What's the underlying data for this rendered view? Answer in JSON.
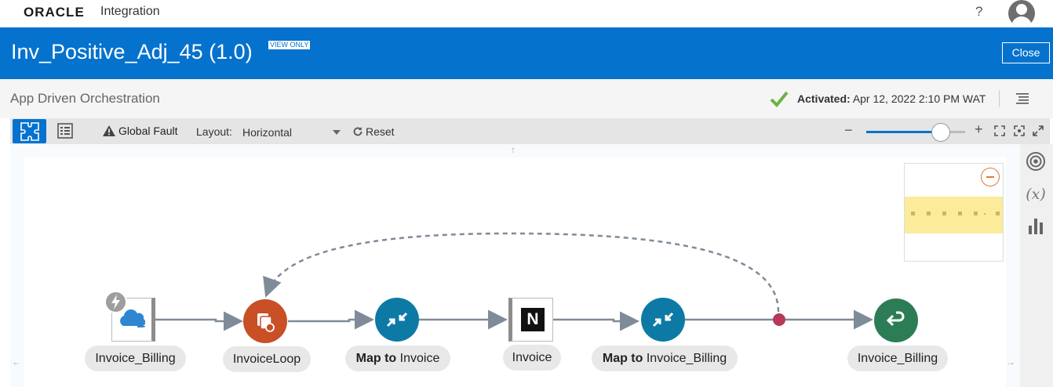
{
  "brand": {
    "logo": "ORACLE",
    "product": "Integration"
  },
  "header": {
    "help": "?"
  },
  "integration": {
    "title": "Inv_Positive_Adj_45 (1.0)",
    "badge": "VIEW ONLY",
    "close_label": "Close"
  },
  "subheader": {
    "pattern": "App Driven Orchestration",
    "status_label": "Activated:",
    "status_value": "Apr 12, 2022 2:10 PM WAT"
  },
  "toolbar": {
    "global_fault": "Global Fault",
    "layout_label": "Layout:",
    "layout_value": "Horizontal",
    "reset": "Reset",
    "zoom_minus": "−",
    "zoom_plus": "+",
    "zoom_level": 0.75
  },
  "flow": {
    "nodes": [
      {
        "id": "trigger",
        "label": "Invoice_Billing",
        "icon": "cloud-app-icon"
      },
      {
        "id": "loop",
        "label": "InvoiceLoop",
        "icon": "for-each-icon",
        "color": "#c84f26"
      },
      {
        "id": "map1",
        "label_prefix": "Map to",
        "label_suffix": " Invoice",
        "icon": "map-icon",
        "color": "#0d7aa6"
      },
      {
        "id": "invoke",
        "label": "Invoice",
        "icon": "netsuite-icon",
        "glyph": "N"
      },
      {
        "id": "map2",
        "label_prefix": "Map to",
        "label_suffix": " Invoice_Billing",
        "icon": "map-icon",
        "color": "#0d7aa6"
      },
      {
        "id": "return",
        "label": "Invoice_Billing",
        "icon": "return-icon",
        "color": "#2c7d55"
      }
    ]
  },
  "rail": {
    "variables_label": "(x)"
  },
  "colors": {
    "brand_blue": "#0572ce",
    "success": "#6cb244",
    "loop_end": "#b7385a"
  }
}
